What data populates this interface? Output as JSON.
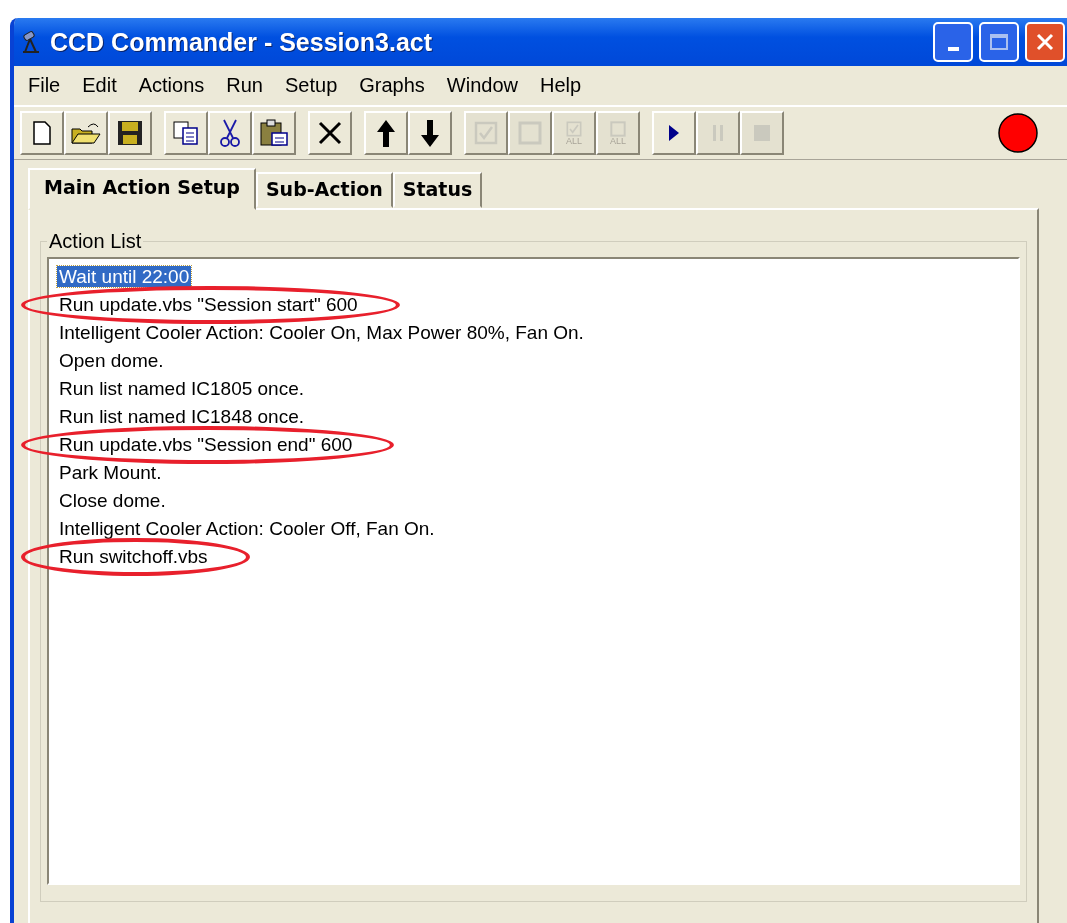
{
  "window": {
    "title": "CCD Commander - Session3.act"
  },
  "menu": [
    "File",
    "Edit",
    "Actions",
    "Run",
    "Setup",
    "Graphs",
    "Window",
    "Help"
  ],
  "toolbar": [
    [
      {
        "kind": "new",
        "disabled": false
      },
      {
        "kind": "open",
        "disabled": false
      },
      {
        "kind": "save",
        "disabled": false
      }
    ],
    [
      {
        "kind": "copy",
        "disabled": false
      },
      {
        "kind": "cut",
        "disabled": false
      },
      {
        "kind": "paste",
        "disabled": false
      }
    ],
    [
      {
        "kind": "delete",
        "disabled": false
      }
    ],
    [
      {
        "kind": "up",
        "disabled": false
      },
      {
        "kind": "down",
        "disabled": false
      }
    ],
    [
      {
        "kind": "check",
        "disabled": true
      },
      {
        "kind": "uncheck",
        "disabled": true
      },
      {
        "kind": "check",
        "disabled": true,
        "label": "ALL"
      },
      {
        "kind": "uncheck",
        "disabled": true,
        "label": "ALL"
      }
    ],
    [
      {
        "kind": "play",
        "disabled": false
      },
      {
        "kind": "pause",
        "disabled": true
      },
      {
        "kind": "stop",
        "disabled": true
      }
    ]
  ],
  "status_light": {
    "color": "#ff0000"
  },
  "tabs": [
    {
      "label": "Main Action Setup",
      "selected": true
    },
    {
      "label": "Sub-Action",
      "selected": false
    },
    {
      "label": "Status",
      "selected": false
    }
  ],
  "action_list": {
    "title": "Action List",
    "items": [
      {
        "text": "Wait until 22:00",
        "selected": true,
        "circled": false
      },
      {
        "text": "Run update.vbs \"Session start\" 600",
        "selected": false,
        "circled": true
      },
      {
        "text": "Intelligent Cooler Action: Cooler On, Max Power 80%, Fan On.",
        "selected": false,
        "circled": false
      },
      {
        "text": "Open dome.",
        "selected": false,
        "circled": false
      },
      {
        "text": "Run list named IC1805 once.",
        "selected": false,
        "circled": false
      },
      {
        "text": "Run list named IC1848 once.",
        "selected": false,
        "circled": false
      },
      {
        "text": "Run update.vbs \"Session end\" 600",
        "selected": false,
        "circled": true
      },
      {
        "text": "Park Mount.",
        "selected": false,
        "circled": false
      },
      {
        "text": "Close dome.",
        "selected": false,
        "circled": false
      },
      {
        "text": "Intelligent Cooler Action: Cooler Off, Fan On.",
        "selected": false,
        "circled": false
      },
      {
        "text": "Run switchoff.vbs",
        "selected": false,
        "circled": true
      }
    ]
  }
}
